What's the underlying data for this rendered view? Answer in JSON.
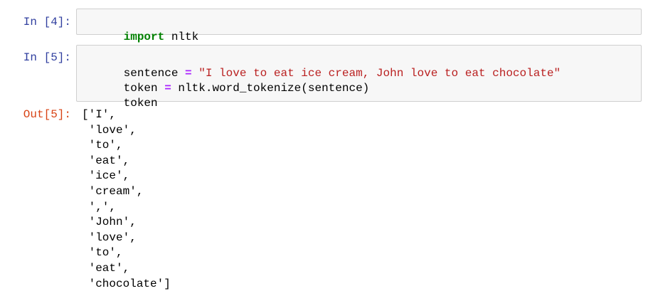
{
  "cells": [
    {
      "prompt": "In [4]:",
      "lines": [
        [
          {
            "t": "import",
            "c": "kw"
          },
          {
            "t": " nltk",
            "c": ""
          }
        ]
      ]
    },
    {
      "prompt": "In [5]:",
      "lines": [
        [
          {
            "t": "sentence ",
            "c": ""
          },
          {
            "t": "=",
            "c": "op"
          },
          {
            "t": " ",
            "c": ""
          },
          {
            "t": "\"I love to eat ice cream, John love to eat chocolate\"",
            "c": "str"
          }
        ],
        [
          {
            "t": "token ",
            "c": ""
          },
          {
            "t": "=",
            "c": "op"
          },
          {
            "t": " nltk.word_tokenize(sentence)",
            "c": ""
          }
        ],
        [
          {
            "t": "token",
            "c": ""
          }
        ]
      ]
    }
  ],
  "output": {
    "prompt": "Out[5]:",
    "lines": [
      "['I',",
      " 'love',",
      " 'to',",
      " 'eat',",
      " 'ice',",
      " 'cream',",
      " ',',",
      " 'John',",
      " 'love',",
      " 'to',",
      " 'eat',",
      " 'chocolate']"
    ]
  }
}
